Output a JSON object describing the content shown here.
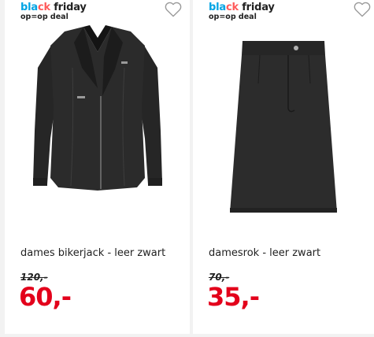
{
  "products": [
    {
      "badge": {
        "word1": "bla",
        "word2": "ck",
        "word3": " friday",
        "deal": "op=op deal"
      },
      "title": "dames bikerjack - leer zwart",
      "old_price": "120,-",
      "price": "60,-",
      "wishlist_icon": "heart-outline-icon",
      "image_alt": "leather biker jacket"
    },
    {
      "badge": {
        "word1": "bla",
        "word2": "ck",
        "word3": " friday",
        "deal": "op=op deal"
      },
      "title": "damesrok - leer zwart",
      "old_price": "70,-",
      "price": "35,-",
      "wishlist_icon": "heart-outline-icon",
      "image_alt": "leather skirt"
    }
  ],
  "colors": {
    "price": "#e3001b",
    "badge_blue": "#00a4e4",
    "badge_red": "#ff5a5a",
    "text": "#222222"
  }
}
